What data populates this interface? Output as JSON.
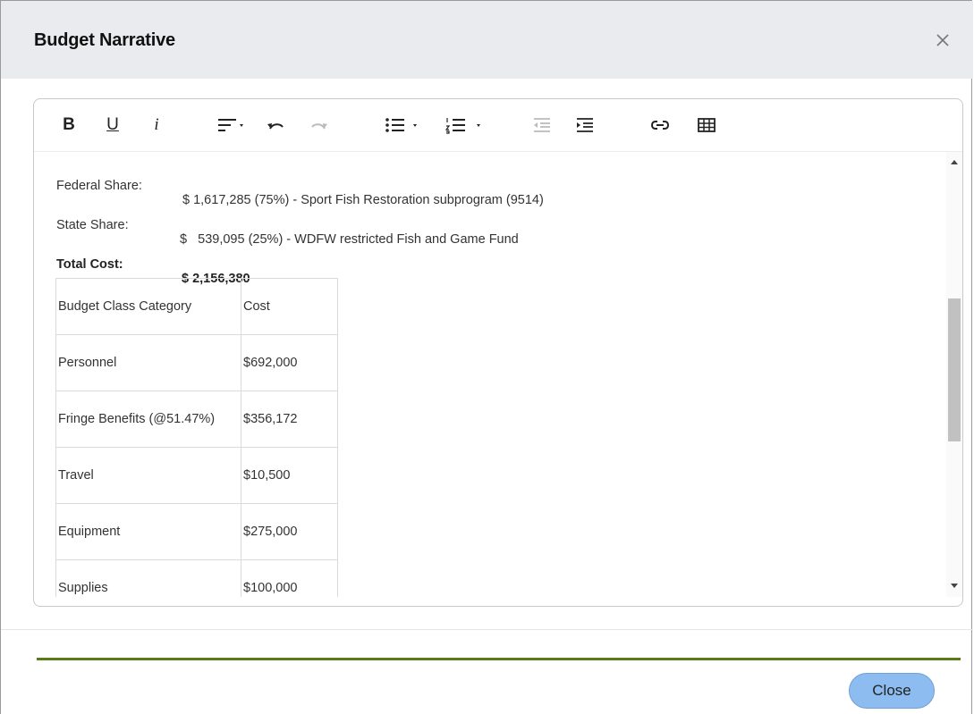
{
  "dialog": {
    "title": "Budget Narrative",
    "close_icon": "close-icon",
    "close_button_label": "Close",
    "accent_line_color": "#5b7a1a",
    "button_color": "#8dbcf0"
  },
  "toolbar": {
    "bold_label": "B",
    "underline_label": "U",
    "italic_label": "i",
    "icons": [
      "align-icon",
      "undo-icon",
      "redo-icon",
      "bullet-list-icon",
      "numbered-list-icon",
      "outdent-icon",
      "indent-icon",
      "link-icon",
      "table-icon"
    ]
  },
  "content": {
    "federal_label": "Federal Share:",
    "federal_value": "$ 1,617,285 (75%) - Sport Fish Restoration subprogram (9514)",
    "state_label": "State Share:",
    "state_value": "$   539,095 (25%) - WDFW restricted Fish and Game Fund",
    "total_label": "Total Cost:",
    "total_value": "$ 2,156,380",
    "table": {
      "headers": [
        "Budget Class Category",
        "Cost"
      ],
      "rows": [
        [
          "Personnel",
          "$692,000"
        ],
        [
          "Fringe Benefits (@51.47%)",
          "$356,172"
        ],
        [
          "Travel",
          "$10,500"
        ],
        [
          "Equipment",
          "$275,000"
        ],
        [
          "Supplies",
          "$100,000"
        ]
      ]
    }
  }
}
